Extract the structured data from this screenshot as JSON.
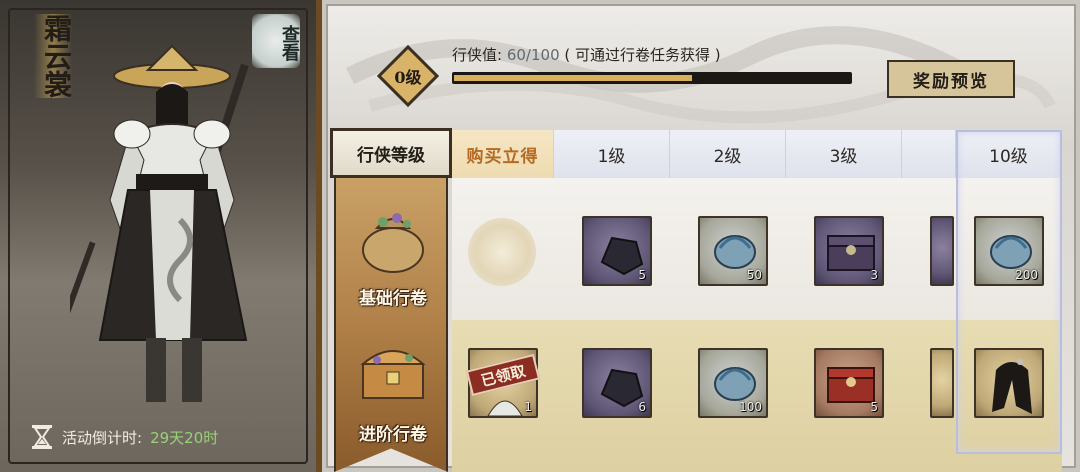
{
  "character": {
    "name": "霜云裳",
    "view_label": "查看",
    "countdown_label": "活动倒计时:",
    "countdown_value": "29天20时"
  },
  "progress": {
    "level_label": "0级",
    "xp_label": "行侠值:",
    "xp_value": "60/100",
    "xp_hint": "( 可通过行卷任务获得 )",
    "xp_fraction": 0.6
  },
  "reward_preview_label": "奖励预览",
  "tiers": {
    "header": "行侠等级",
    "basic": "基础行卷",
    "advanced": "进阶行卷"
  },
  "columns": [
    {
      "label": "购买立得"
    },
    {
      "label": "1级"
    },
    {
      "label": "2级"
    },
    {
      "label": "3级"
    },
    {
      "label": ""
    },
    {
      "label": "10级"
    }
  ],
  "basic_rewards": [
    {
      "item": "locked-orb",
      "count": ""
    },
    {
      "item": "dark-ore",
      "count": "5"
    },
    {
      "item": "blue-jade",
      "count": "50"
    },
    {
      "item": "purple-chest",
      "count": "3"
    },
    {
      "item": "partial",
      "count": ""
    },
    {
      "item": "blue-jade",
      "count": "200"
    }
  ],
  "advanced_rewards": [
    {
      "item": "character-portrait",
      "count": "1",
      "claimed_label": "已领取"
    },
    {
      "item": "dark-ore",
      "count": "6"
    },
    {
      "item": "blue-jade",
      "count": "100"
    },
    {
      "item": "red-chest",
      "count": "5"
    },
    {
      "item": "partial",
      "count": ""
    },
    {
      "item": "hair-style",
      "count": ""
    }
  ],
  "colors": {
    "accent_gold": "#d9b15b",
    "buy_text": "#b56a24",
    "claimed_red": "#8b2d22",
    "countdown_green": "#9ad17a"
  }
}
